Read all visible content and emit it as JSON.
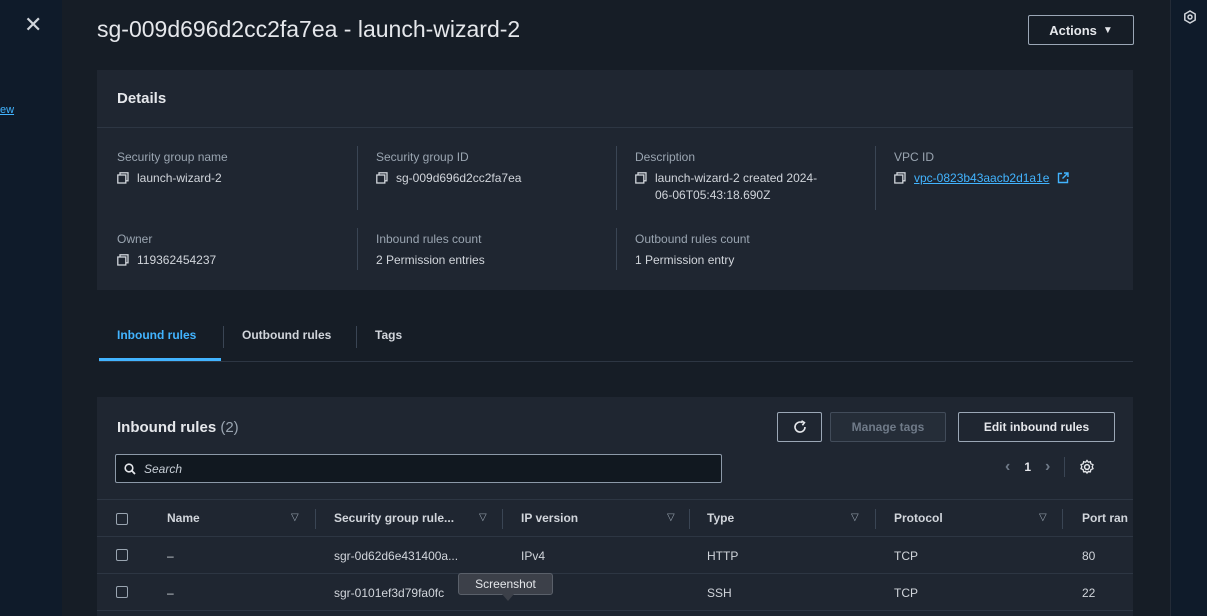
{
  "edge_link": "ew",
  "header": {
    "title": "sg-009d696d2cc2fa7ea - launch-wizard-2",
    "actions_label": "Actions"
  },
  "details": {
    "heading": "Details",
    "fields": [
      {
        "label": "Security group name",
        "value": "launch-wizard-2"
      },
      {
        "label": "Security group ID",
        "value": "sg-009d696d2cc2fa7ea"
      },
      {
        "label": "Description",
        "value": "launch-wizard-2 created 2024-06-06T05:43:18.690Z"
      },
      {
        "label": "VPC ID",
        "value": "vpc-0823b43aacb2d1a1e"
      },
      {
        "label": "Owner",
        "value": "119362454237"
      },
      {
        "label": "Inbound rules count",
        "value": "2 Permission entries"
      },
      {
        "label": "Outbound rules count",
        "value": "1 Permission entry"
      }
    ]
  },
  "tabs": [
    {
      "label": "Inbound rules",
      "active": true
    },
    {
      "label": "Outbound rules",
      "active": false
    },
    {
      "label": "Tags",
      "active": false
    }
  ],
  "inbound": {
    "title": "Inbound rules",
    "count": "(2)",
    "manage_tags_label": "Manage tags",
    "edit_label": "Edit inbound rules",
    "search_placeholder": "Search",
    "page": "1",
    "columns": [
      "Name",
      "Security group rule...",
      "IP version",
      "Type",
      "Protocol",
      "Port ran"
    ],
    "rows": [
      {
        "name": "–",
        "rule_id": "sgr-0d62d6e431400a...",
        "ip_version": "IPv4",
        "type": "HTTP",
        "protocol": "TCP",
        "port": "80"
      },
      {
        "name": "–",
        "rule_id": "sgr-0101ef3d79fa0fc",
        "ip_version": "",
        "type": "SSH",
        "protocol": "TCP",
        "port": "22"
      }
    ]
  },
  "tooltip": "Screenshot",
  "colors": {
    "accent": "#42b4ff",
    "panel": "#1f2631",
    "background": "#161d26"
  }
}
